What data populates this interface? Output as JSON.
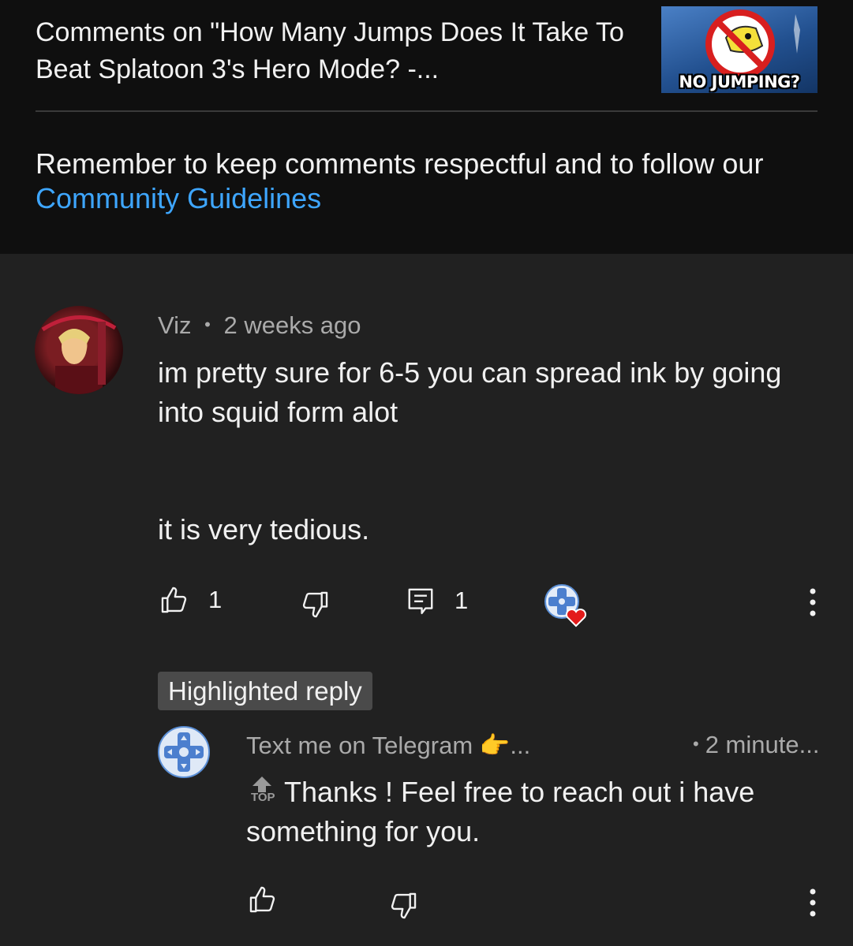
{
  "header": {
    "title": "Comments on \"How Many Jumps Does It Take To Beat Splatoon 3's Hero Mode? -...",
    "thumbnail_label": "NO JUMPING?",
    "reminder_text": "Remember to keep comments respectful and to follow our ",
    "guidelines_link": "Community Guidelines"
  },
  "comment": {
    "author": "Viz",
    "separator": "•",
    "time": "2 weeks ago",
    "text_line_1": "im pretty sure for 6-5 you can spread ink by going into squid form alot",
    "text_line_2": "it is very tedious.",
    "likes": "1",
    "replies": "1",
    "creator_heart_icon": "heart-badge-icon"
  },
  "reply": {
    "badge": "Highlighted reply",
    "author": "Text me on Telegram 👉...",
    "separator": "•",
    "time": "2 minute...",
    "top_icon_label": "TOP",
    "text": "Thanks ! Feel free to reach out i have something for you."
  },
  "colors": {
    "background": "#212121",
    "header_background": "#0f0f0f",
    "link": "#3ea6ff",
    "meta_text": "#aaaaaa",
    "badge": "#4a4a4a"
  }
}
